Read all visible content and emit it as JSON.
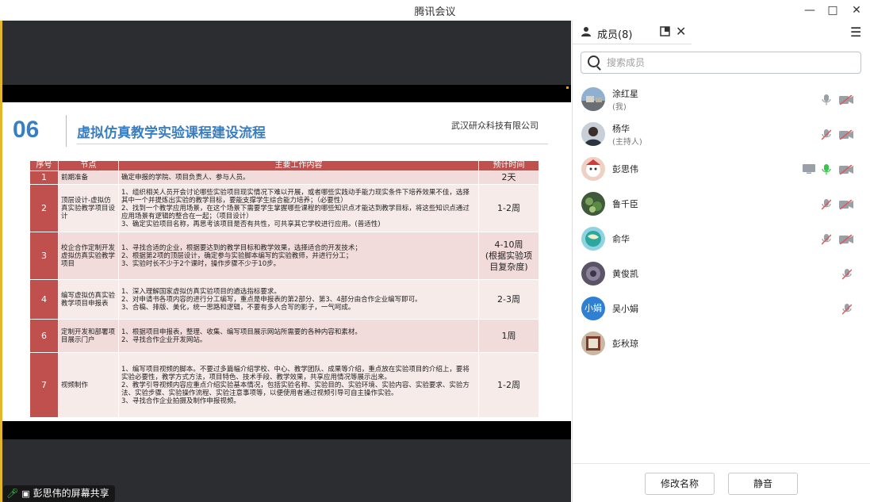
{
  "window": {
    "title": "腾讯会议"
  },
  "slide": {
    "number": "06",
    "title": "虚拟仿真教学实验课程建设流程",
    "company": "武汉研众科技有限公司",
    "table": {
      "headers": [
        "序号",
        "节点",
        "主要工作内容",
        "预计时间"
      ],
      "rows": [
        {
          "seq": "1",
          "node": "前期准备",
          "content": "确定申报的学院、项目负责人、参与人员。",
          "time": "2天"
        },
        {
          "seq": "2",
          "node": "顶层设计-虚拟仿真实验教学项目设计",
          "content": "1、组织相关人员开会讨论哪些实验项目现实情况下难以开展，或者哪些实践动手能力现实条件下培养效果不佳，选择其中一个并提炼出实验的教学目标，要能支撑学生综合能力培养；（必要性）\n2、找到一个教学应用场景，在这个场景下需要学生掌握哪些课程的哪些知识点才能达到教学目标，将这些知识点通过应用场景有逻辑的整合在一起；（项目设计）\n3、确定实验项目名称，再思考该项目是否有共性，可共享其它学校进行应用。(普适性)",
          "time": "1-2周"
        },
        {
          "seq": "3",
          "node": "校企合作定制开发虚拟仿真实验教学项目",
          "content": "1、寻找合适的企业，根据要达到的教学目标和教学效果，选择适合的开发技术；\n2、根据第2项的顶层设计，确定参与实验脚本编写的实验教师，并进行分工；\n3、实验时长不少于2个课时，操作步骤不少于10步。",
          "time": "4-10周\n(根据实验项目复杂度)"
        },
        {
          "seq": "4",
          "node": "编写虚拟仿真实验教学项目申报表",
          "content": "1、深入理解国家虚拟仿真实验项目的遴选指标要求。\n2、对申请书各项内容的进行分工编写，重点是申报表的第2部分、第3、4部分由合作企业编写即可。\n3、合稿、排版、美化，统一思路和逻辑，不要有多人合写的影子，一气呵成。",
          "time": "2-3周"
        },
        {
          "seq": "6",
          "node": "定制开发和部署项目展示门户",
          "content": "1、根据项目申报表，整理、收集、编写项目展示网站所需要的各种内容和素材。\n2、寻找合作企业开发网站。",
          "time": "1周"
        },
        {
          "seq": "7",
          "node": "视频制作",
          "content": "1、编写项目视频的脚本。不要过多篇幅介绍学校、中心、教学团队、成果等介绍，重点放在实验项目的介绍上，要将实验必要性，教学方式方法，项目特色、技术手段、教学效果，共享应用情况等展示出来。\n2、教学引导视频内容应重点介绍实验基本情况，包括实验名称、实验目的、实验环境、实验内容、实验要求、实验方法、实验步骤、实验操作流程、实验注意事项等，以便使用者通过视频引导可自主操作实验。\n3、寻找合作企业拍摄及制作申报视频。",
          "time": "1-2周"
        }
      ]
    }
  },
  "share_badge": {
    "label": "彭思伟的屏幕共享"
  },
  "panel": {
    "title": "成员(8)",
    "search_placeholder": "搜索成员",
    "members": [
      {
        "name": "涂红星",
        "role": "(我)",
        "avatar_type": "photo-building",
        "mic": "normal",
        "cam": "off"
      },
      {
        "name": "杨华",
        "role": "(主持人)",
        "avatar_type": "photo-person",
        "mic": "muted",
        "cam": "off"
      },
      {
        "name": "彭思伟",
        "role": "",
        "avatar_type": "photo-cartoon",
        "screen": "sharing",
        "mic": "active",
        "cam": "off"
      },
      {
        "name": "鲁千臣",
        "role": "",
        "avatar_type": "photo-plant",
        "mic": "muted",
        "cam": "off"
      },
      {
        "name": "俞华",
        "role": "",
        "avatar_type": "photo-globe",
        "mic": "muted",
        "cam": "off"
      },
      {
        "name": "黄俊凯",
        "role": "",
        "avatar_type": "photo-dark",
        "mic": "muted"
      },
      {
        "name": "吴小娟",
        "role": "",
        "avatar_type": "text",
        "avatar_text": "小娟",
        "mic": "muted"
      },
      {
        "name": "彭秋琼",
        "role": "",
        "avatar_type": "photo-book"
      }
    ],
    "buttons": {
      "rename": "修改名称",
      "mute": "静音"
    }
  },
  "colors": {
    "accent_blue": "#3a7ec2",
    "table_header": "#c0504d",
    "table_cell": "#f2dcdb",
    "mic_active": "#3ac44a",
    "muted_red": "#e05555"
  }
}
